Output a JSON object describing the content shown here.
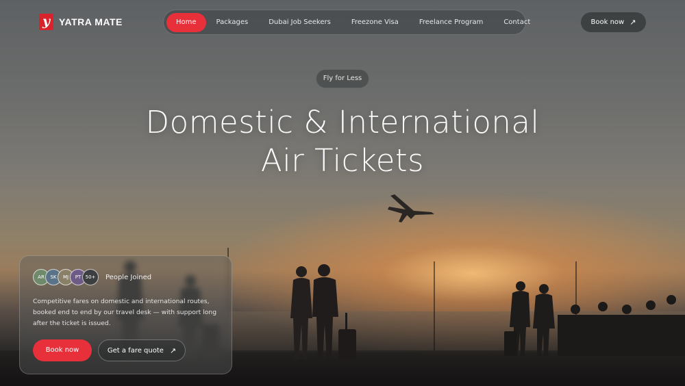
{
  "brand": {
    "name": "YATRA MATE",
    "mark": "y"
  },
  "nav": {
    "items": [
      {
        "label": "Home",
        "active": true
      },
      {
        "label": "Packages",
        "active": false
      },
      {
        "label": "Dubai Job Seekers",
        "active": false
      },
      {
        "label": "Freezone Visa",
        "active": false
      },
      {
        "label": "Freelance Program",
        "active": false
      },
      {
        "label": "Contact",
        "active": false
      }
    ],
    "book_label": "Book now",
    "book_icon": "arrow-up-right-icon"
  },
  "hero": {
    "pill": "Fly for Less",
    "title_line1": "Domestic & International",
    "title_line2": "Air Tickets"
  },
  "card": {
    "avatars": [
      "AR",
      "SK",
      "MJ",
      "PT",
      "50+"
    ],
    "avatar_colors": [
      "#6f8a6a",
      "#5b7388",
      "#8a8068",
      "#6e5b86",
      "#3c3e40"
    ],
    "joined_label": "People Joined",
    "description": "Competitive fares on domestic and international routes, booked end to end by our travel desk — with support long after the ticket is issued.",
    "primary_button": "Book now",
    "secondary_button": "Get a fare quote",
    "secondary_icon": "arrow-up-right-icon"
  },
  "colors": {
    "accent": "#e7303a",
    "brand_red": "#d8222c"
  }
}
